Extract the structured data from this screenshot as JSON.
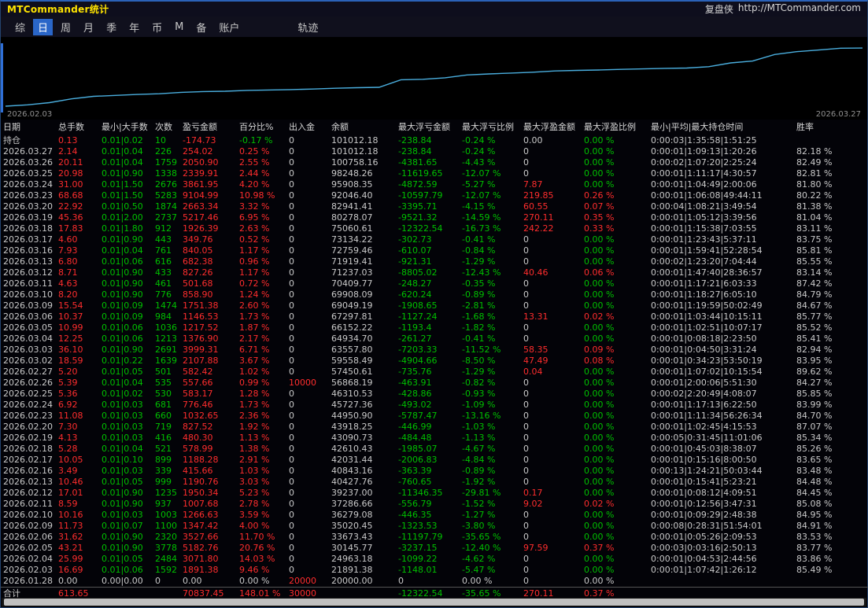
{
  "window": {
    "title": "MTCommander统计",
    "brand": "复盘侠",
    "brand_url": "http://MTCommander.com"
  },
  "menu": {
    "items": [
      {
        "label": "综",
        "active": false,
        "gap": false
      },
      {
        "label": "日",
        "active": true,
        "gap": false
      },
      {
        "label": "周",
        "active": false,
        "gap": false
      },
      {
        "label": "月",
        "active": false,
        "gap": false
      },
      {
        "label": "季",
        "active": false,
        "gap": false
      },
      {
        "label": "年",
        "active": false,
        "gap": false
      },
      {
        "label": "币",
        "active": false,
        "gap": false
      },
      {
        "label": "M",
        "active": false,
        "gap": false
      },
      {
        "label": "备",
        "active": false,
        "gap": false
      },
      {
        "label": "账户",
        "active": false,
        "gap": false
      },
      {
        "label": "轨迹",
        "active": false,
        "gap": true
      }
    ]
  },
  "chart": {
    "start_label": "2026.02.03",
    "end_label": "2026.03.27"
  },
  "chart_data": {
    "type": "line",
    "title": "账户余额曲线",
    "xlabel": "日期",
    "ylabel": "余额",
    "ylim": [
      20000,
      101100
    ],
    "legend": "none",
    "grid": false,
    "line_color": "#4aaede",
    "x": [
      "2026.01.28",
      "2026.02.03",
      "2026.02.04",
      "2026.02.05",
      "2026.02.06",
      "2026.02.09",
      "2026.02.10",
      "2026.02.11",
      "2026.02.12",
      "2026.02.13",
      "2026.02.16",
      "2026.02.17",
      "2026.02.18",
      "2026.02.19",
      "2026.02.20",
      "2026.02.23",
      "2026.02.24",
      "2026.02.25",
      "2026.02.26",
      "2026.02.27",
      "2026.03.02",
      "2026.03.03",
      "2026.03.04",
      "2026.03.05",
      "2026.03.06",
      "2026.03.09",
      "2026.03.10",
      "2026.03.11",
      "2026.03.12",
      "2026.03.13",
      "2026.03.16",
      "2026.03.17",
      "2026.03.18",
      "2026.03.19",
      "2026.03.20",
      "2026.03.23",
      "2026.03.24",
      "2026.03.25",
      "2026.03.26",
      "2026.03.27"
    ],
    "series": [
      {
        "name": "余额",
        "values": [
          20000.0,
          21891.38,
          24963.18,
          30145.77,
          33673.43,
          35020.45,
          36279.08,
          37286.66,
          39237.0,
          40427.76,
          40843.16,
          42031.44,
          42610.43,
          43090.73,
          43918.25,
          44950.9,
          45727.36,
          46310.53,
          56868.19,
          57450.61,
          59558.49,
          63557.8,
          64934.7,
          66152.22,
          67297.81,
          69049.19,
          69908.09,
          70409.77,
          71237.03,
          71919.41,
          72759.46,
          73134.22,
          75060.61,
          80278.07,
          82941.41,
          92046.4,
          95908.35,
          98248.26,
          100758.16,
          101012.18
        ]
      }
    ]
  },
  "table": {
    "headers": [
      "日期",
      "总手数",
      "最小|大手数",
      "次数",
      "盈亏金额",
      "百分比%",
      "出入金",
      "余额",
      "最大浮亏金额",
      "最大浮亏比例",
      "最大浮盈金额",
      "最大浮盈比例",
      "最小|平均|最大持仓时间",
      "胜率"
    ],
    "rows": [
      {
        "cells": [
          "持仓",
          "0.13",
          "0.01|0.02",
          "10",
          "-174.73",
          "-0.17 %",
          "0",
          "101012.18",
          "-238.84",
          "-0.24 %",
          "0.00",
          "0.00 %",
          "0:00:03|1:35:58|1:51:25",
          ""
        ],
        "colors": "wrggrgwwggwgww"
      },
      {
        "cells": [
          "2026.03.27",
          "2.14",
          "0.01|0.04",
          "226",
          "254.02",
          "0.25 %",
          "0",
          "101012.18",
          "-238.84",
          "-0.24 %",
          "0",
          "0.00 %",
          "0:00:01|1:09:13|1:20:26",
          "82.18 %"
        ],
        "colors": "wrggrrwwggwgww"
      },
      {
        "cells": [
          "2026.03.26",
          "20.11",
          "0.01|0.04",
          "1759",
          "2050.90",
          "2.55 %",
          "0",
          "100758.16",
          "-4381.65",
          "-4.43 %",
          "0",
          "0.00 %",
          "0:00:02|1:07:20|2:25:24",
          "82.49 %"
        ],
        "colors": "wrggrrwwggwgww"
      },
      {
        "cells": [
          "2026.03.25",
          "20.98",
          "0.01|0.90",
          "1338",
          "2339.91",
          "2.44 %",
          "0",
          "98248.26",
          "-11619.65",
          "-12.07 %",
          "0",
          "0.00 %",
          "0:00:01|1:11:17|4:30:57",
          "82.81 %"
        ],
        "colors": "wrggrrwwggwgww"
      },
      {
        "cells": [
          "2026.03.24",
          "31.00",
          "0.01|1.50",
          "2676",
          "3861.95",
          "4.20 %",
          "0",
          "95908.35",
          "-4872.59",
          "-5.27 %",
          "7.87",
          "0.00 %",
          "0:00:01|1:04:49|2:00:06",
          "81.80 %"
        ],
        "colors": "wrggrrwwggrgww"
      },
      {
        "cells": [
          "2026.03.23",
          "68.68",
          "0.01|1.50",
          "5283",
          "9104.99",
          "10.98 %",
          "0",
          "92046.40",
          "-10597.79",
          "-12.07 %",
          "219.85",
          "0.26 %",
          "0:00:01|1:06:08|49:44:11",
          "80.22 %"
        ],
        "colors": "wrggrrwwggrrww"
      },
      {
        "cells": [
          "2026.03.20",
          "22.92",
          "0.01|0.50",
          "1874",
          "2663.34",
          "3.32 %",
          "0",
          "82941.41",
          "-3395.71",
          "-4.15 %",
          "60.55",
          "0.07 %",
          "0:00:04|1:08:21|3:49:54",
          "81.38 %"
        ],
        "colors": "wrggrrwwggrrww"
      },
      {
        "cells": [
          "2026.03.19",
          "45.36",
          "0.01|2.00",
          "2737",
          "5217.46",
          "6.95 %",
          "0",
          "80278.07",
          "-9521.32",
          "-14.59 %",
          "270.11",
          "0.35 %",
          "0:00:01|1:05:12|3:39:56",
          "81.04 %"
        ],
        "colors": "wrggrrwwggrrww"
      },
      {
        "cells": [
          "2026.03.18",
          "17.83",
          "0.01|1.80",
          "912",
          "1926.39",
          "2.63 %",
          "0",
          "75060.61",
          "-12322.54",
          "-16.73 %",
          "242.22",
          "0.33 %",
          "0:00:01|1:15:38|7:03:55",
          "83.11 %"
        ],
        "colors": "wrggrrwwggrrww"
      },
      {
        "cells": [
          "2026.03.17",
          "4.60",
          "0.01|0.90",
          "443",
          "349.76",
          "0.52 %",
          "0",
          "73134.22",
          "-302.73",
          "-0.41 %",
          "0",
          "0.00 %",
          "0:00:01|1:23:43|5:37:11",
          "83.75 %"
        ],
        "colors": "wrggrrwwggwgww"
      },
      {
        "cells": [
          "2026.03.16",
          "7.93",
          "0.01|0.04",
          "761",
          "840.05",
          "1.17 %",
          "0",
          "72759.46",
          "-610.07",
          "-0.84 %",
          "0",
          "0.00 %",
          "0:00:01|1:59:41|52:28:54",
          "85.81 %"
        ],
        "colors": "wrggrrwwggwgww"
      },
      {
        "cells": [
          "2026.03.13",
          "6.80",
          "0.01|0.06",
          "616",
          "682.38",
          "0.96 %",
          "0",
          "71919.41",
          "-921.31",
          "-1.29 %",
          "0",
          "0.00 %",
          "0:00:02|1:23:20|7:04:44",
          "85.55 %"
        ],
        "colors": "wrggrrwwggwgww"
      },
      {
        "cells": [
          "2026.03.12",
          "8.71",
          "0.01|0.90",
          "433",
          "827.26",
          "1.17 %",
          "0",
          "71237.03",
          "-8805.02",
          "-12.43 %",
          "40.46",
          "0.06 %",
          "0:00:01|1:47:40|28:36:57",
          "83.14 %"
        ],
        "colors": "wrggrrwwggrrww"
      },
      {
        "cells": [
          "2026.03.11",
          "4.63",
          "0.01|0.90",
          "461",
          "501.68",
          "0.72 %",
          "0",
          "70409.77",
          "-248.27",
          "-0.35 %",
          "0",
          "0.00 %",
          "0:00:01|1:17:21|6:03:33",
          "87.42 %"
        ],
        "colors": "wrggrrwwggwgww"
      },
      {
        "cells": [
          "2026.03.10",
          "8.20",
          "0.01|0.90",
          "776",
          "858.90",
          "1.24 %",
          "0",
          "69908.09",
          "-620.24",
          "-0.89 %",
          "0",
          "0.00 %",
          "0:00:01|1:18:27|6:05:10",
          "84.79 %"
        ],
        "colors": "wrggrrwwggwgww"
      },
      {
        "cells": [
          "2026.03.09",
          "15.54",
          "0.01|0.09",
          "1474",
          "1751.38",
          "2.60 %",
          "0",
          "69049.19",
          "-1908.65",
          "-2.81 %",
          "0",
          "0.00 %",
          "0:00:01|1:19:59|50:02:49",
          "84.67 %"
        ],
        "colors": "wrggrrwwggwgww"
      },
      {
        "cells": [
          "2026.03.06",
          "10.37",
          "0.01|0.09",
          "984",
          "1146.53",
          "1.73 %",
          "0",
          "67297.81",
          "-1127.24",
          "-1.68 %",
          "13.31",
          "0.02 %",
          "0:00:01|1:03:44|10:15:11",
          "85.77 %"
        ],
        "colors": "wrggrrwwggrrww"
      },
      {
        "cells": [
          "2026.03.05",
          "10.99",
          "0.01|0.06",
          "1036",
          "1217.52",
          "1.87 %",
          "0",
          "66152.22",
          "-1193.4",
          "-1.82 %",
          "0",
          "0.00 %",
          "0:00:01|1:02:51|10:07:17",
          "85.52 %"
        ],
        "colors": "wrggrrwwggwgww"
      },
      {
        "cells": [
          "2026.03.04",
          "12.25",
          "0.01|0.06",
          "1213",
          "1376.90",
          "2.17 %",
          "0",
          "64934.70",
          "-261.27",
          "-0.41 %",
          "0",
          "0.00 %",
          "0:00:01|0:08:18|2:23:50",
          "85.41 %"
        ],
        "colors": "wrggrrwwggwgww"
      },
      {
        "cells": [
          "2026.03.03",
          "36.10",
          "0.01|0.90",
          "2691",
          "3999.31",
          "6.71 %",
          "0",
          "63557.80",
          "-7203.33",
          "-11.52 %",
          "58.35",
          "0.09 %",
          "0:00:01|0:04:50|3:31:24",
          "82.94 %"
        ],
        "colors": "wrggrrwwggrrww"
      },
      {
        "cells": [
          "2026.03.02",
          "18.59",
          "0.01|0.22",
          "1639",
          "2107.88",
          "3.67 %",
          "0",
          "59558.49",
          "-4904.66",
          "-8.50 %",
          "47.49",
          "0.08 %",
          "0:00:01|0:34:23|53:50:19",
          "83.95 %"
        ],
        "colors": "wrggrrwwggrrww"
      },
      {
        "cells": [
          "2026.02.27",
          "5.20",
          "0.01|0.05",
          "501",
          "582.42",
          "1.02 %",
          "0",
          "57450.61",
          "-735.76",
          "-1.29 %",
          "0.04",
          "0.00 %",
          "0:00:01|1:07:02|10:15:54",
          "89.62 %"
        ],
        "colors": "wrggrrwwggrgww"
      },
      {
        "cells": [
          "2026.02.26",
          "5.39",
          "0.01|0.04",
          "535",
          "557.66",
          "0.99 %",
          "10000",
          "56868.19",
          "-463.91",
          "-0.82 %",
          "0",
          "0.00 %",
          "0:00:01|2:00:06|5:51:30",
          "84.27 %"
        ],
        "colors": "wrggrrrwggwgww"
      },
      {
        "cells": [
          "2026.02.25",
          "5.36",
          "0.01|0.02",
          "530",
          "583.17",
          "1.28 %",
          "0",
          "46310.53",
          "-428.86",
          "-0.93 %",
          "0",
          "0.00 %",
          "0:00:02|2:20:49|4:08:07",
          "85.85 %"
        ],
        "colors": "wrggrrwwggwgww"
      },
      {
        "cells": [
          "2026.02.24",
          "6.92",
          "0.01|0.03",
          "681",
          "776.46",
          "1.73 %",
          "0",
          "45727.36",
          "-493.02",
          "-1.09 %",
          "0",
          "0.00 %",
          "0:00:01|1:17:13|6:22:50",
          "83.99 %"
        ],
        "colors": "wrggrrwwggwgww"
      },
      {
        "cells": [
          "2026.02.23",
          "11.08",
          "0.01|0.03",
          "660",
          "1032.65",
          "2.36 %",
          "0",
          "44950.90",
          "-5787.47",
          "-13.16 %",
          "0",
          "0.00 %",
          "0:00:01|1:11:34|56:26:34",
          "84.70 %"
        ],
        "colors": "wrggrrwwggwgww"
      },
      {
        "cells": [
          "2026.02.20",
          "7.30",
          "0.01|0.03",
          "719",
          "827.52",
          "1.92 %",
          "0",
          "43918.25",
          "-446.99",
          "-1.03 %",
          "0",
          "0.00 %",
          "0:00:01|1:02:45|4:15:53",
          "87.07 %"
        ],
        "colors": "wrggrrwwggwgww"
      },
      {
        "cells": [
          "2026.02.19",
          "4.13",
          "0.01|0.03",
          "416",
          "480.30",
          "1.13 %",
          "0",
          "43090.73",
          "-484.48",
          "-1.13 %",
          "0",
          "0.00 %",
          "0:00:05|0:31:45|11:01:06",
          "85.34 %"
        ],
        "colors": "wrggrrwwggwgww"
      },
      {
        "cells": [
          "2026.02.18",
          "5.28",
          "0.01|0.04",
          "521",
          "578.99",
          "1.38 %",
          "0",
          "42610.43",
          "-1985.07",
          "-4.67 %",
          "0",
          "0.00 %",
          "0:00:01|0:45:03|8:38:07",
          "85.26 %"
        ],
        "colors": "wrggrrwwggwgww"
      },
      {
        "cells": [
          "2026.02.17",
          "10.05",
          "0.01|0.10",
          "899",
          "1188.28",
          "2.91 %",
          "0",
          "42031.44",
          "-2006.83",
          "-4.84 %",
          "0",
          "0.00 %",
          "0:00:01|0:15:16|8:00:50",
          "83.65 %"
        ],
        "colors": "wrggrrwwggwgww"
      },
      {
        "cells": [
          "2026.02.16",
          "3.49",
          "0.01|0.03",
          "339",
          "415.66",
          "1.03 %",
          "0",
          "40843.16",
          "-363.39",
          "-0.89 %",
          "0",
          "0.00 %",
          "0:00:13|1:24:21|50:03:44",
          "83.48 %"
        ],
        "colors": "wrggrrwwggwgww"
      },
      {
        "cells": [
          "2026.02.13",
          "10.46",
          "0.01|0.05",
          "999",
          "1190.76",
          "3.03 %",
          "0",
          "40427.76",
          "-760.65",
          "-1.92 %",
          "0",
          "0.00 %",
          "0:00:01|0:15:41|5:23:21",
          "84.48 %"
        ],
        "colors": "wrggrrwwggwgww"
      },
      {
        "cells": [
          "2026.02.12",
          "17.01",
          "0.01|0.90",
          "1235",
          "1950.34",
          "5.23 %",
          "0",
          "39237.00",
          "-11346.35",
          "-29.81 %",
          "0.17",
          "0.00 %",
          "0:00:01|0:08:12|4:09:51",
          "84.45 %"
        ],
        "colors": "wrggrrwwggrgww"
      },
      {
        "cells": [
          "2026.02.11",
          "8.59",
          "0.01|0.90",
          "937",
          "1007.68",
          "2.78 %",
          "0",
          "37286.66",
          "-556.79",
          "-1.52 %",
          "9.02",
          "0.02 %",
          "0:00:01|0:12:56|3:47:31",
          "85.08 %"
        ],
        "colors": "wrggrrwwggrrww"
      },
      {
        "cells": [
          "2026.02.10",
          "10.16",
          "0.01|0.03",
          "1003",
          "1266.63",
          "3.59 %",
          "0",
          "36279.08",
          "-446.35",
          "-1.27 %",
          "0",
          "0.00 %",
          "0:00:01|0:09:29|2:48:38",
          "84.95 %"
        ],
        "colors": "wrggrrwwggwgww"
      },
      {
        "cells": [
          "2026.02.09",
          "11.73",
          "0.01|0.07",
          "1100",
          "1347.42",
          "4.00 %",
          "0",
          "35020.45",
          "-1323.53",
          "-3.80 %",
          "0",
          "0.00 %",
          "0:00:08|0:28:31|51:54:01",
          "84.91 %"
        ],
        "colors": "wrggrrwwggwgww"
      },
      {
        "cells": [
          "2026.02.06",
          "31.62",
          "0.01|0.90",
          "2320",
          "3527.66",
          "11.70 %",
          "0",
          "33673.43",
          "-11197.79",
          "-35.65 %",
          "0",
          "0.00 %",
          "0:00:01|0:05:26|2:09:53",
          "83.53 %"
        ],
        "colors": "wrggrrwwggwgww"
      },
      {
        "cells": [
          "2026.02.05",
          "43.21",
          "0.01|0.90",
          "3778",
          "5182.76",
          "20.76 %",
          "0",
          "30145.77",
          "-3237.15",
          "-12.40 %",
          "97.59",
          "0.37 %",
          "0:00:03|0:03:16|2:50:13",
          "83.77 %"
        ],
        "colors": "wrggrrwwggrrww"
      },
      {
        "cells": [
          "2026.02.04",
          "25.99",
          "0.01|0.05",
          "2484",
          "3071.80",
          "14.03 %",
          "0",
          "24963.18",
          "-1099.22",
          "-4.62 %",
          "0",
          "0.00 %",
          "0:00:01|0:04:53|2:44:56",
          "83.86 %"
        ],
        "colors": "wrggrrwwggwgww"
      },
      {
        "cells": [
          "2026.02.03",
          "16.69",
          "0.01|0.06",
          "1592",
          "1891.38",
          "9.46 %",
          "0",
          "21891.38",
          "-1148.01",
          "-5.47 %",
          "0",
          "0.00 %",
          "0:00:01|1:07:42|1:26:12",
          "85.49 %"
        ],
        "colors": "wrggrrwwggwgww"
      },
      {
        "cells": [
          "2026.01.28",
          "0.00",
          "0.00|0.00",
          "0",
          "0.00",
          "0.00 %",
          "20000",
          "20000.00",
          "0",
          "0.00 %",
          "0",
          "0.00 %",
          "",
          ""
        ],
        "colors": "wwwwwwrwwwwwww"
      }
    ],
    "footer": {
      "cells": [
        "合计",
        "613.65",
        "",
        "",
        "70837.45",
        "148.01 %",
        "30000",
        "",
        "-12322.54",
        "-35.65 %",
        "270.11",
        "0.37 %",
        "",
        ""
      ],
      "colors": "wrwwrrrwggrrww"
    }
  },
  "colors": {
    "profit_red": "#ff2d2d",
    "loss_green": "#00c000",
    "text": "#c9c9c9",
    "title_yellow": "#ffe400",
    "menu_active_bg": "#2a66c8",
    "chart_line": "#4aaede",
    "chart_accent": "#2f6fd6"
  }
}
